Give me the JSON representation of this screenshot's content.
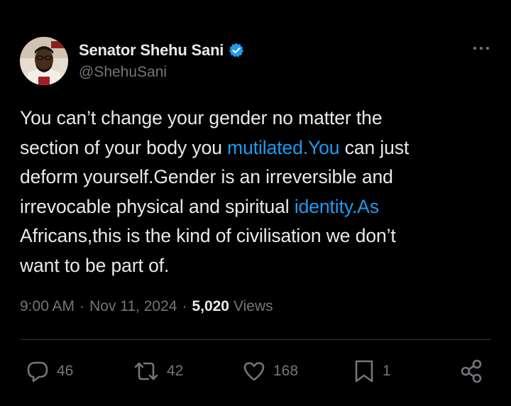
{
  "author": {
    "display_name": "Senator Shehu Sani",
    "handle": "@ShehuSani",
    "verified": true,
    "avatar": "portrait-photo"
  },
  "tweet": {
    "lines": [
      [
        {
          "text": "You can’t change your gender no matter the",
          "link": false
        }
      ],
      [
        {
          "text": "section of your body you ",
          "link": false
        },
        {
          "text": "mutilated.You",
          "link": true
        },
        {
          "text": " can just",
          "link": false
        }
      ],
      [
        {
          "text": "deform yourself.Gender is an irreversible and",
          "link": false
        }
      ],
      [
        {
          "text": "irrevocable physical and spiritual ",
          "link": false
        },
        {
          "text": "identity.As",
          "link": true
        }
      ],
      [
        {
          "text": "Africans,this is the kind of civilisation we don’t",
          "link": false
        }
      ],
      [
        {
          "text": "want to be part of.",
          "link": false
        }
      ]
    ],
    "time": "9:00 AM",
    "separator": "·",
    "date": "Nov 11, 2024",
    "views_count": "5,020",
    "views_label": "Views"
  },
  "actions": {
    "replies": "46",
    "reposts": "42",
    "likes": "168",
    "bookmarks": "1"
  },
  "icons": {
    "more": "more-icon",
    "reply": "reply-icon",
    "repost": "repost-icon",
    "like": "heart-icon",
    "bookmark": "bookmark-icon",
    "share": "share-icon",
    "verified": "verified-badge-icon"
  },
  "colors": {
    "background": "#000000",
    "text": "#e7e9ea",
    "secondary": "#71767b",
    "link": "#1d9bf0",
    "divider": "#2f3336"
  }
}
